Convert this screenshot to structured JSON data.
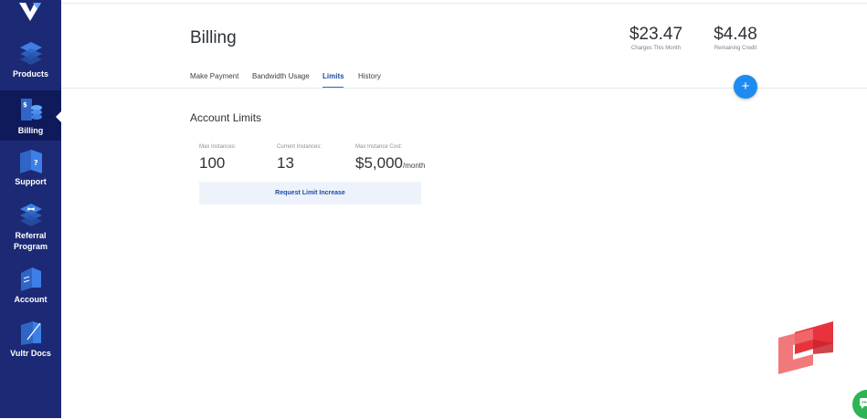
{
  "sidebar": {
    "items": [
      {
        "label": "Products",
        "icon": "products-icon"
      },
      {
        "label": "Billing",
        "icon": "billing-icon",
        "active": true
      },
      {
        "label": "Support",
        "icon": "support-icon"
      },
      {
        "label": "Referral\nProgram",
        "label_line1": "Referral",
        "label_line2": "Program",
        "icon": "referral-icon"
      },
      {
        "label": "Account",
        "icon": "account-icon"
      },
      {
        "label": "Vultr Docs",
        "icon": "docs-icon"
      }
    ]
  },
  "header": {
    "title": "Billing",
    "charges": {
      "value": "$23.47",
      "label": "Charges This Month"
    },
    "credit": {
      "value": "$4.48",
      "label": "Remaining Credit"
    }
  },
  "tabs": [
    {
      "label": "Make Payment"
    },
    {
      "label": "Bandwidth Usage"
    },
    {
      "label": "Limits",
      "active": true
    },
    {
      "label": "History"
    }
  ],
  "fab": {
    "label": "+"
  },
  "limits": {
    "title": "Account Limits",
    "max_instances": {
      "label": "Max Instances:",
      "value": "100"
    },
    "current_instances": {
      "label": "Current Instances:",
      "value": "13"
    },
    "max_cost": {
      "label": "Max Instance Cost:",
      "value": "$5,000",
      "unit": "/month"
    },
    "request_button": "Request Limit Increase"
  },
  "colors": {
    "sidebar": "#1c2a76",
    "sidebar_active": "#0e1a5a",
    "accent": "#1e8bf0",
    "link": "#1f4ba8",
    "chat": "#2db553",
    "brand_mark": "#e8323c"
  }
}
